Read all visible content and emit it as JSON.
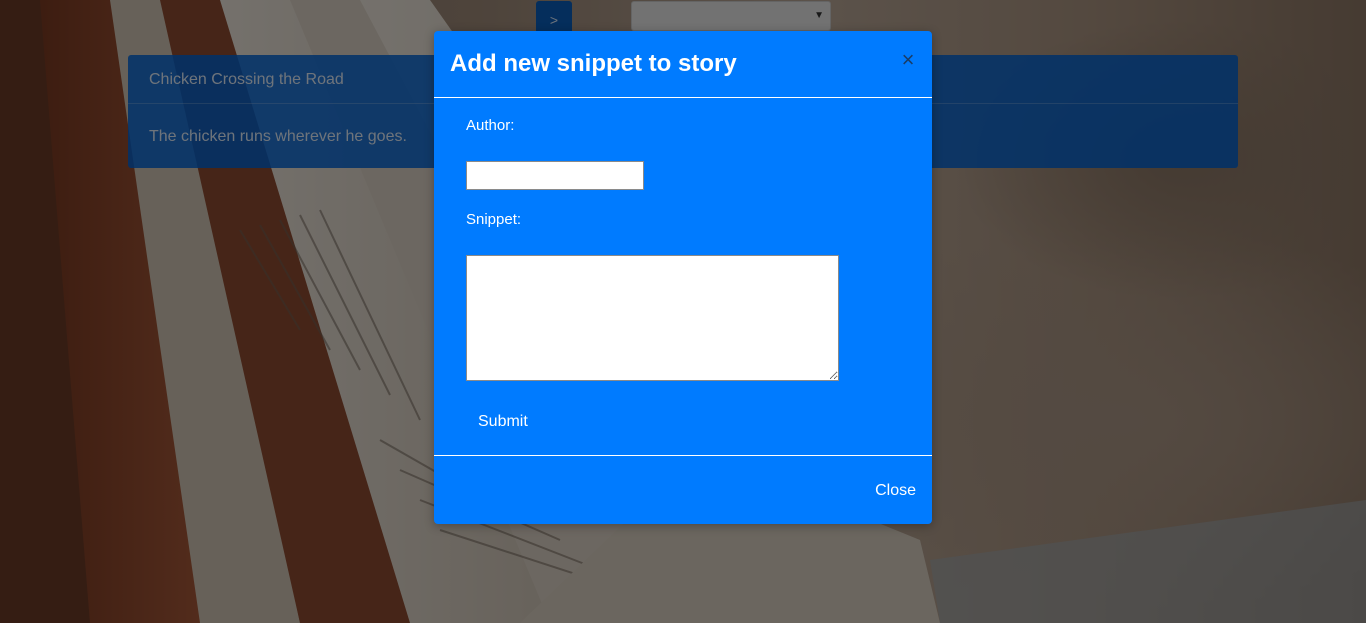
{
  "nav": {
    "next_label": ">"
  },
  "story_select": {
    "selected": ""
  },
  "story": {
    "title": "Chicken Crossing the Road",
    "snippet": "The chicken runs wherever he goes."
  },
  "modal": {
    "title": "Add new snippet to story",
    "close_symbol": "×",
    "author_label": "Author:",
    "author_value": "",
    "snippet_label": "Snippet:",
    "snippet_value": "",
    "submit_label": "Submit",
    "footer_close_label": "Close"
  },
  "colors": {
    "modal_bg": "#007bff",
    "panel_bg": "#0062d2",
    "nav_button_bg": "#0a5cb8"
  },
  "icons": {
    "close": "close-icon",
    "caret": "chevron-down-icon"
  }
}
